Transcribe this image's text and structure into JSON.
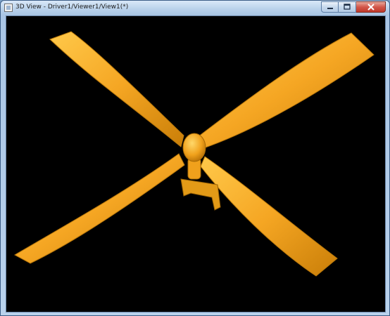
{
  "window": {
    "title": "3D View - Driver1/Viewer1/View1(*)",
    "icon": "app-window-icon",
    "caption_buttons": [
      "minimize-icon",
      "maximize-icon",
      "close-icon"
    ]
  },
  "viewport": {
    "background_color": "#000000",
    "model_color": "#f5a623",
    "model": "four-blade-propeller"
  }
}
